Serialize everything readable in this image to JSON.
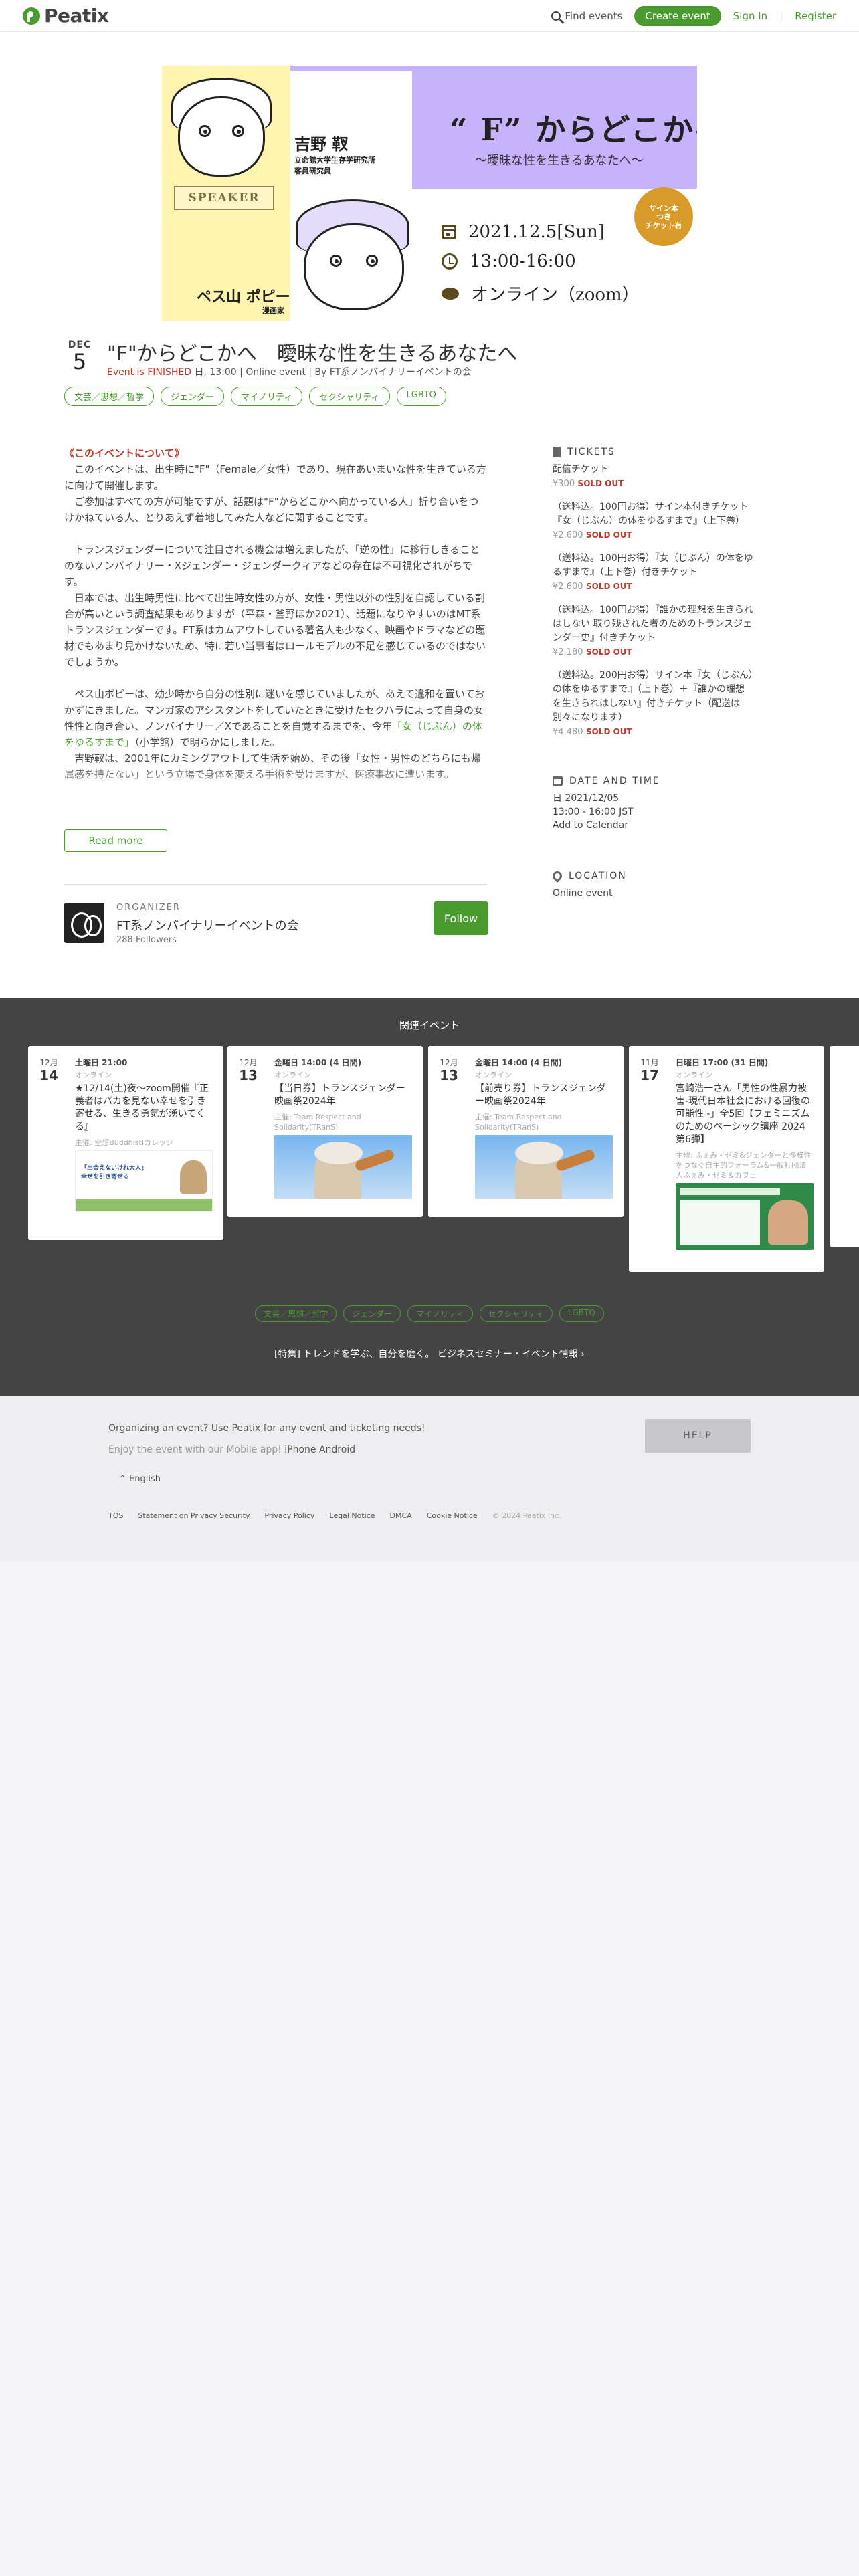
{
  "header": {
    "logo": "Peatix",
    "find_events": "Find events",
    "create_event": "Create event",
    "sign_in": "Sign In",
    "register": "Register"
  },
  "hero": {
    "title": "“ F” からどこかへ",
    "subtitle": "〜曖昧な性を生きるあなたへ〜",
    "speaker_name": "吉野 靫",
    "speaker_affiliation": [
      "立命館大学生存学研究所",
      "客員研究員"
    ],
    "speaker_badge": "SPEAKER",
    "host_name": "ペス山 ポピー",
    "host_role": "漫画家",
    "date": "2021.12.5[Sun]",
    "time": "13:00-16:00",
    "place": "オンライン（zoom）",
    "seal_lines": [
      "サイン本",
      "つき",
      "チケット有"
    ]
  },
  "event": {
    "month": "DEC",
    "day": "5",
    "title": "\"F\"からどこかへ　曖昧な性を生きるあなたへ",
    "status": "Event is FINISHED",
    "meta": " 日, 13:00 | Online event | By FT系ノンバイナリーイベントの会",
    "tags": [
      "文芸／思想／哲学",
      "ジェンダー",
      "マイノリティ",
      "セクシャリティ",
      "LGBTQ"
    ]
  },
  "description": {
    "heading": "《このイベントについて》",
    "p1": "　このイベントは、出生時に\"F\"（Female／女性）であり、現在あいまいな性を生きている方に向けて開催します。",
    "p2": "　ご参加はすべての方が可能ですが、話題は\"F\"からどこかへ向かっている人」折り合いをつけかねている人、とりあえず着地してみた人などに関することです。",
    "p3": "　トランスジェンダーについて注目される機会は増えましたが、「逆の性」に移行しきることのないノンバイナリー・Xジェンダー・ジェンダークィアなどの存在は不可視化されがちです。",
    "p4": "　日本では、出生時男性に比べて出生時女性の方が、女性・男性以外の性別を自認している割合が高いという調査結果もありますが（平森・釜野ほか2021）、話題になりやすいのはMT系トランスジェンダーです。FT系はカムアウトしている著名人も少なく、映画やドラマなどの題材でもあまり見かけないため、特に若い当事者はロールモデルの不足を感じているのではないでしょうか。",
    "p5a": "　ペス山ポピーは、幼少時から自分の性別に迷いを感じていましたが、あえて違和を置いておかずにきました。マンガ家のアシスタントをしていたときに受けたセクハラによって自身の女性性と向き合い、ノンバイナリー／Xであることを自覚するまでを、今年",
    "p5link": "「女（じぶん）の体をゆるすまで」",
    "p5b": "（小学館）で明らかにしました。",
    "p6": "　吉野靫は、2001年にカミングアウトして生活を始め、その後「女性・男性のどちらにも帰属感を持たない」という立場で身体を変える手術を受けますが、医療事故に遭います。",
    "read_more": "Read more"
  },
  "organizer": {
    "label": "ORGANIZER",
    "name": "FT系ノンバイナリーイベントの会",
    "followers": "288 Followers",
    "follow": "Follow"
  },
  "sidebar": {
    "tickets_heading": "TICKETS",
    "tickets": [
      {
        "name": "配信チケット",
        "price": "¥300",
        "status": "SOLD OUT"
      },
      {
        "name": "（送料込。100円お得）サイン本付きチケット『女（じぶん）の体をゆるすまで』（上下巻）",
        "price": "¥2,600",
        "status": "SOLD OUT"
      },
      {
        "name": "（送料込。100円お得）『女（じぶん）の体をゆるすまで』（上下巻）付きチケット",
        "price": "¥2,600",
        "status": "SOLD OUT"
      },
      {
        "name": "（送料込。100円お得）『誰かの理想を生きられはしない 取り残された者のためのトランスジェンダー史』付きチケット",
        "price": "¥2,180",
        "status": "SOLD OUT"
      },
      {
        "name": "（送料込。200円お得）サイン本『女（じぶん）の体をゆるすまで』（上下巻）＋『誰かの理想を生きられはしない』付きチケット（配送は別々になります）",
        "price": "¥4,480",
        "status": "SOLD OUT"
      }
    ],
    "datetime_heading": "DATE AND TIME",
    "date_line": "日 2021/12/05",
    "time_line": "13:00 - 16:00 JST",
    "add_calendar": "Add to Calendar",
    "location_heading": "LOCATION",
    "location": "Online event"
  },
  "related": {
    "heading": "関連イベント",
    "cards": [
      {
        "mon": "12月",
        "day": "14",
        "when": "土曜日 21:00",
        "where": "オンライン",
        "title": "★12/14(土)夜～zoom開催『正義者はバカを見ない幸せを引き寄せる、生きる勇気が湧いてくる』",
        "org": "主催: 空想BuddhistIカレッジ"
      },
      {
        "mon": "12月",
        "day": "13",
        "when": "金曜日 14:00 (4 日間)",
        "where": "オンライン",
        "title": "【当日券】トランスジェンダー映画祭2024年",
        "org": "主催: Team Respect and Solidarity(TRanS)"
      },
      {
        "mon": "12月",
        "day": "13",
        "when": "金曜日 14:00 (4 日間)",
        "where": "オンライン",
        "title": "【前売り券】トランスジェンダー映画祭2024年",
        "org": "主催: Team Respect and Solidarity(TRanS)"
      },
      {
        "mon": "11月",
        "day": "17",
        "when": "日曜日 17:00 (31 日間)",
        "where": "オンライン",
        "title": "宮崎浩一さん「男性の性暴力被害-現代日本社会における回復の可能性 -」全5回【フェミニズムのためのベーシック講座 2024 第6弾】",
        "org": "主催: ふぇみ・ゼミ&ジェンダーと多様性をつなぐ自主的フォーラム&一般社団法人ふぇみ・ゼミ＆カフェ"
      }
    ],
    "card1_banner": "「出会えないけれ大人」\n幸せを引き寄せる",
    "tags": [
      "文芸／思想／哲学",
      "ジェンダー",
      "マイノリティ",
      "セクシャリティ",
      "LGBTQ"
    ],
    "special": "[特集] トレンドを学ぶ、自分を磨く。 ビジネスセミナー・イベント情報"
  },
  "footer": {
    "organizing": "Organizing an event? Use Peatix for any event and ticketing needs!",
    "app_prefix": "Enjoy the event with our Mobile app! ",
    "app_ios": "iPhone",
    "app_android": "Android",
    "help": "HELP",
    "lang": "⌃ English",
    "links": [
      "TOS",
      "Statement on Privacy Security",
      "Privacy Policy",
      "Legal Notice",
      "DMCA",
      "Cookie Notice"
    ],
    "copyright": "© 2024 Peatix Inc."
  }
}
